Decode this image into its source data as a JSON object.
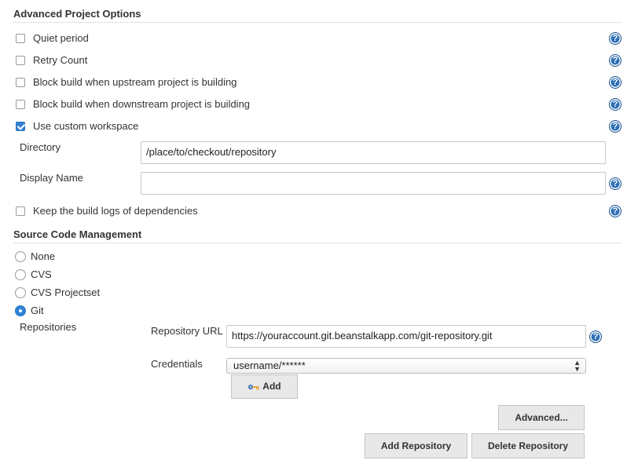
{
  "advanced": {
    "title": "Advanced Project Options",
    "options": [
      {
        "label": "Quiet period",
        "checked": false
      },
      {
        "label": "Retry Count",
        "checked": false
      },
      {
        "label": "Block build when upstream project is building",
        "checked": false
      },
      {
        "label": "Block build when downstream project is building",
        "checked": false
      },
      {
        "label": "Use custom workspace",
        "checked": true
      }
    ],
    "directory": {
      "label": "Directory",
      "value": "/place/to/checkout/repository"
    },
    "display_name": {
      "label": "Display Name",
      "value": ""
    },
    "keep_logs": {
      "label": "Keep the build logs of dependencies",
      "checked": false
    }
  },
  "scm": {
    "title": "Source Code Management",
    "options": [
      {
        "label": "None",
        "selected": false
      },
      {
        "label": "CVS",
        "selected": false
      },
      {
        "label": "CVS Projectset",
        "selected": false
      },
      {
        "label": "Git",
        "selected": true
      }
    ],
    "repositories_label": "Repositories",
    "repo_url": {
      "label": "Repository URL",
      "value": "https://youraccount.git.beanstalkapp.com/git-repository.git"
    },
    "credentials": {
      "label": "Credentials",
      "value": "username/******"
    },
    "add_label": "Add",
    "advanced_label": "Advanced...",
    "add_repo_label": "Add Repository",
    "delete_repo_label": "Delete Repository"
  },
  "help_glyph": "?",
  "icons": {
    "help": "help-icon",
    "key": "key-icon"
  },
  "colors": {
    "accent": "#2f83d6",
    "help": "#2d6fb6",
    "button": "#e8e8e8"
  }
}
